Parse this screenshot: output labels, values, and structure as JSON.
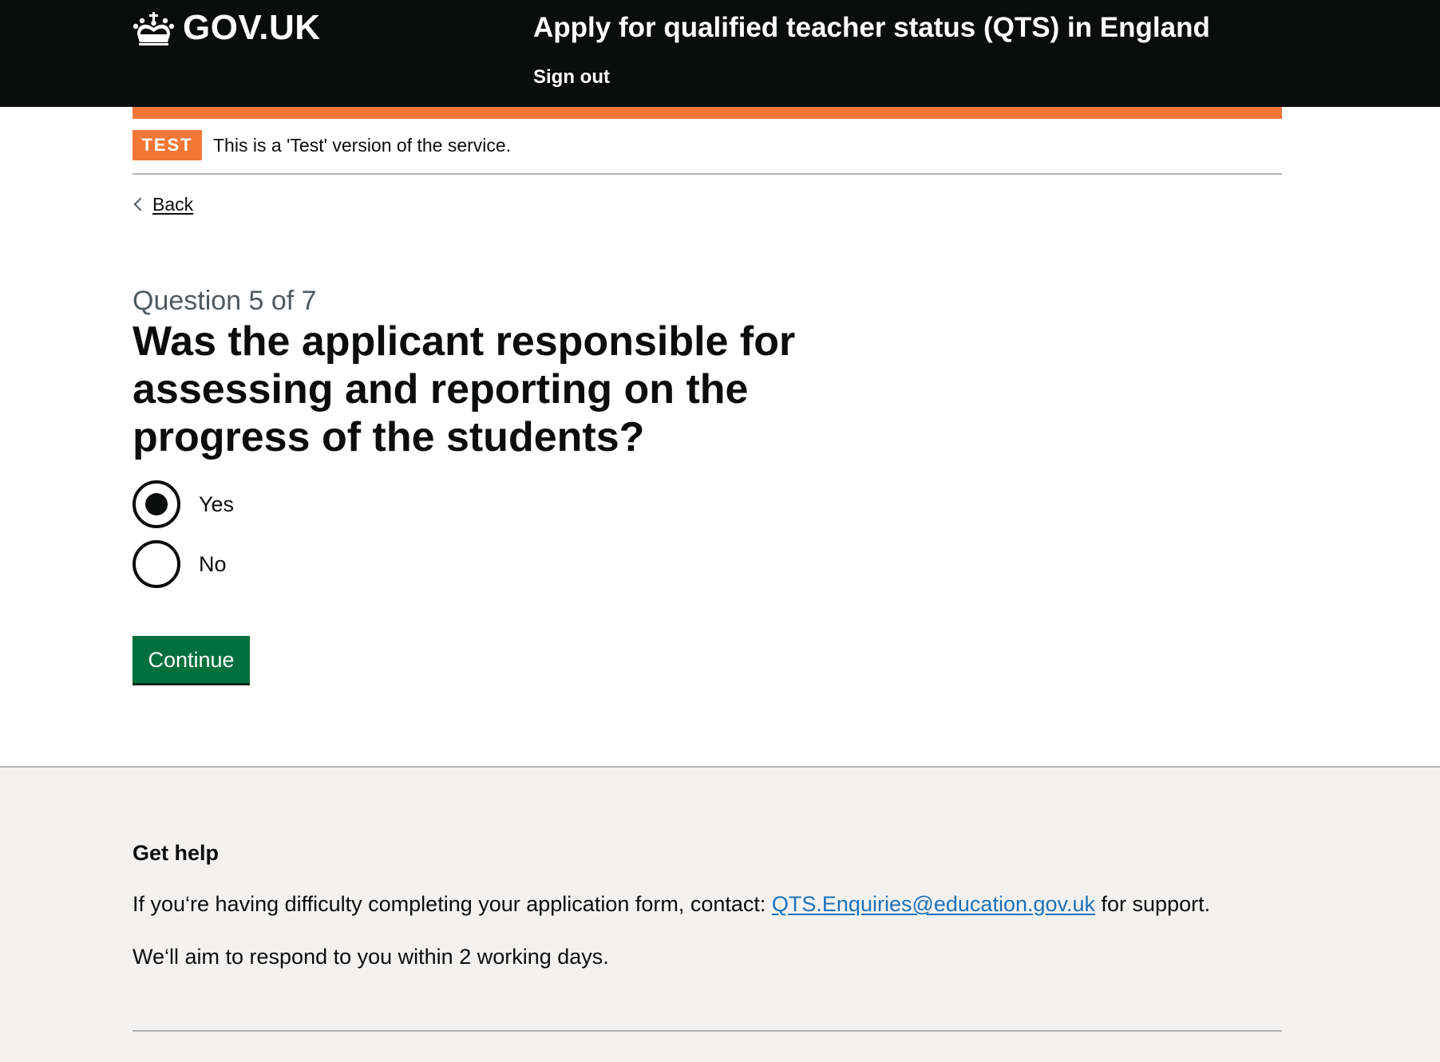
{
  "header": {
    "logo_text": "GOV.UK",
    "service_name": "Apply for qualified teacher status (QTS) in England",
    "sign_out": "Sign out"
  },
  "phase_banner": {
    "tag": "TEST",
    "text": "This is a 'Test' version of the service."
  },
  "back_link": "Back",
  "question": {
    "caption": "Question 5 of 7",
    "heading": "Was the applicant responsible for assessing and reporting on the progress of the students?",
    "options": [
      {
        "label": "Yes",
        "checked": true
      },
      {
        "label": "No",
        "checked": false
      }
    ]
  },
  "continue_button": "Continue",
  "footer": {
    "heading": "Get help",
    "help_prefix": "If you‘re having difficulty completing your application form, contact: ",
    "help_email": "QTS.Enquiries@education.gov.uk",
    "help_suffix": " for support.",
    "response_time": "We‘ll aim to respond to you within 2 working days."
  },
  "colors": {
    "header_bg": "#0b0c0c",
    "phase_orange": "#f47738",
    "button_green": "#00703c",
    "link_blue": "#1d70b8",
    "footer_bg": "#f3f2f1",
    "caption_grey": "#505a5f"
  },
  "icons": {
    "logo": "crown-icon",
    "back": "chevron-left-icon"
  }
}
